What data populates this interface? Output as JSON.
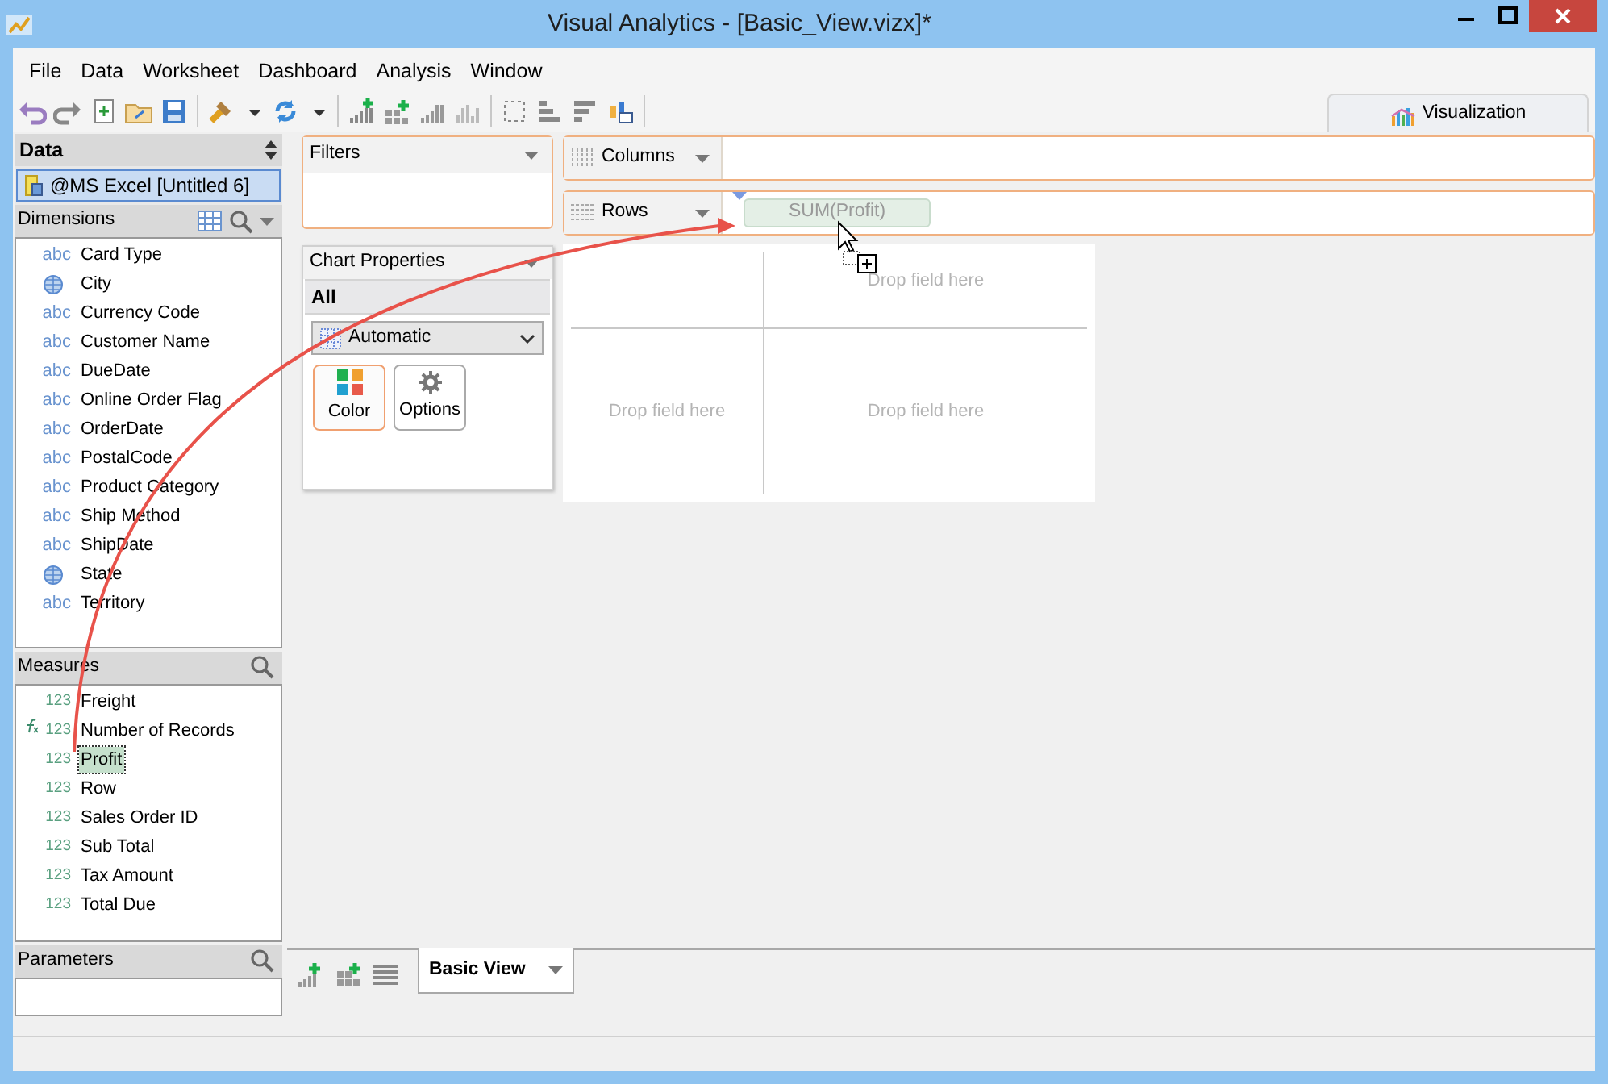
{
  "window": {
    "title": "Visual Analytics - [Basic_View.vizx]*"
  },
  "menu": [
    "File",
    "Data",
    "Worksheet",
    "Dashboard",
    "Analysis",
    "Window"
  ],
  "view_tab": {
    "label": "Visualization",
    "selected": true
  },
  "data_panel": {
    "title": "Data",
    "source": {
      "label": "@MS Excel [Untitled 6]",
      "selected": true
    },
    "dimensions": {
      "title": "Dimensions",
      "items": [
        {
          "label": "Card Type",
          "kind": "text",
          "type_label": "abc"
        },
        {
          "label": "City",
          "kind": "geo"
        },
        {
          "label": "Currency Code",
          "kind": "text",
          "type_label": "abc"
        },
        {
          "label": "Customer Name",
          "kind": "text",
          "type_label": "abc"
        },
        {
          "label": "DueDate",
          "kind": "text",
          "type_label": "abc"
        },
        {
          "label": "Online Order Flag",
          "kind": "text",
          "type_label": "abc"
        },
        {
          "label": "OrderDate",
          "kind": "text",
          "type_label": "abc"
        },
        {
          "label": "PostalCode",
          "kind": "text",
          "type_label": "abc"
        },
        {
          "label": "Product Category",
          "kind": "text",
          "type_label": "abc"
        },
        {
          "label": "Ship Method",
          "kind": "text",
          "type_label": "abc"
        },
        {
          "label": "ShipDate",
          "kind": "text",
          "type_label": "abc"
        },
        {
          "label": "State",
          "kind": "geo"
        },
        {
          "label": "Territory",
          "kind": "text",
          "type_label": "abc"
        }
      ]
    },
    "measures": {
      "title": "Measures",
      "items": [
        {
          "label": "Freight",
          "kind": "measure",
          "type_label": "123",
          "selected": false
        },
        {
          "label": "Number of Records",
          "kind": "calculated",
          "type_label": "123",
          "selected": false
        },
        {
          "label": "Profit",
          "kind": "measure",
          "type_label": "123",
          "selected": true
        },
        {
          "label": "Row",
          "kind": "measure",
          "type_label": "123",
          "selected": false
        },
        {
          "label": "Sales Order ID",
          "kind": "measure",
          "type_label": "123",
          "selected": false
        },
        {
          "label": "Sub Total",
          "kind": "measure",
          "type_label": "123",
          "selected": false
        },
        {
          "label": "Tax Amount",
          "kind": "measure",
          "type_label": "123",
          "selected": false
        },
        {
          "label": "Total Due",
          "kind": "measure",
          "type_label": "123",
          "selected": false
        }
      ]
    },
    "parameters": {
      "title": "Parameters"
    }
  },
  "filters": {
    "title": "Filters"
  },
  "chart_properties": {
    "title": "Chart Properties",
    "section": "All",
    "chart_type": "Automatic",
    "buttons": [
      {
        "label": "Color",
        "kind": "color",
        "selected": true
      },
      {
        "label": "Options",
        "kind": "options",
        "selected": false
      }
    ]
  },
  "shelves": {
    "columns": {
      "label": "Columns"
    },
    "rows": {
      "label": "Rows",
      "pill": "SUM(Profit)"
    }
  },
  "canvas": {
    "drop_labels": [
      "Drop field here",
      "Drop field here",
      "Drop field here"
    ]
  },
  "sheet_tabs": [
    {
      "label": "Basic View",
      "selected": true
    }
  ]
}
